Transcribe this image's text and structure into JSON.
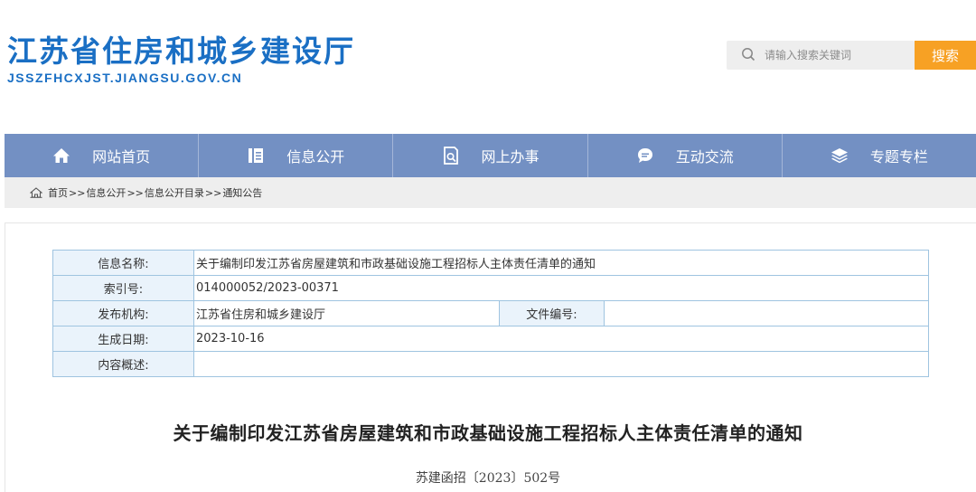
{
  "header": {
    "title": "江苏省住房和城乡建设厅",
    "domain": "JSSZFHCXJST.JIANGSU.GOV.CN"
  },
  "search": {
    "placeholder": "请输入搜索关键词",
    "button_label": "搜索",
    "icon": "search-icon",
    "button_color": "#f7a124"
  },
  "nav": {
    "color": "#7390c3",
    "items": [
      {
        "label": "网站首页",
        "icon": "home-icon"
      },
      {
        "label": "信息公开",
        "icon": "document-list-icon"
      },
      {
        "label": "网上办事",
        "icon": "search-document-icon"
      },
      {
        "label": "互动交流",
        "icon": "chat-bubble-icon"
      },
      {
        "label": "专题专栏",
        "icon": "layers-icon"
      }
    ]
  },
  "breadcrumb": {
    "icon": "home-icon",
    "items": [
      "首页",
      "信息公开",
      "信息公开目录",
      "通知公告"
    ],
    "separator": ">>"
  },
  "meta": {
    "name_label": "信息名称:",
    "name_value": "关于编制印发江苏省房屋建筑和市政基础设施工程招标人主体责任清单的通知",
    "index_label": "索引号:",
    "index_value": "014000052/2023-00371",
    "publisher_label": "发布机构:",
    "publisher_value": "江苏省住房和城乡建设厅",
    "docno_label": "文件编号:",
    "docno_value": "",
    "date_label": "生成日期:",
    "date_value": "2023-10-16",
    "summary_label": "内容概述:",
    "summary_value": ""
  },
  "article": {
    "title": "关于编制印发江苏省房屋建筑和市政基础设施工程招标人主体责任清单的通知",
    "doc_number": "苏建函招〔2023〕502号"
  }
}
